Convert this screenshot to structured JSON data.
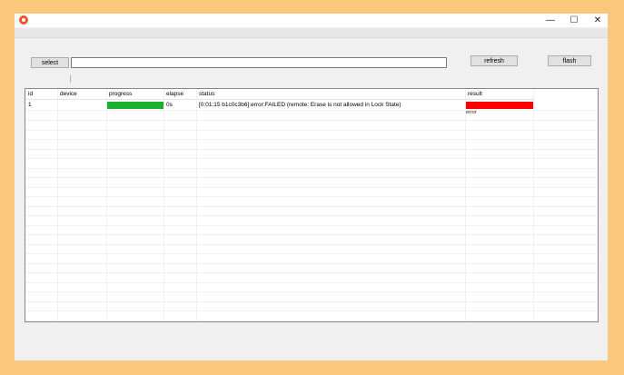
{
  "window": {
    "controls": {
      "minimize": "—",
      "maximize": "☐",
      "close": "✕"
    }
  },
  "toolbar": {
    "select_label": "select",
    "path_value": "",
    "refresh_label": "refresh",
    "flash_label": "flash"
  },
  "table": {
    "columns": [
      "id",
      "device",
      "progress",
      "elapse",
      "status",
      "result"
    ],
    "rows": [
      {
        "id": "1",
        "device": "",
        "progress": 1.0,
        "elapse": "0s",
        "status": "[0:01:15  b1c0c3b6]:error:FAILED (remote: Erase is not allowed in Lock State)",
        "result": "error"
      }
    ]
  },
  "colors": {
    "background": "#f9c87c",
    "progress": "#19b02b",
    "result_error": "#ff0000"
  }
}
